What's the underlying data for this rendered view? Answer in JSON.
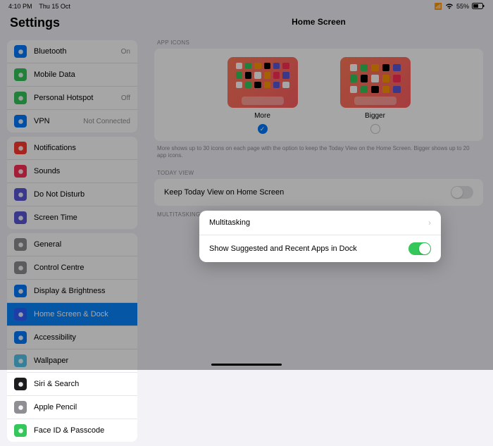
{
  "statusbar": {
    "time": "4:10 PM",
    "date": "Thu 15 Oct",
    "battery": "55%"
  },
  "sidebar": {
    "title": "Settings",
    "groups": [
      [
        {
          "label": "Bluetooth",
          "value": "On",
          "icon": "#007aff",
          "glyph": "bluetooth"
        },
        {
          "label": "Mobile Data",
          "value": "",
          "icon": "#34c759",
          "glyph": "antenna"
        },
        {
          "label": "Personal Hotspot",
          "value": "Off",
          "icon": "#34c759",
          "glyph": "link"
        },
        {
          "label": "VPN",
          "value": "Not Connected",
          "icon": "#007aff",
          "glyph": "vpn"
        }
      ],
      [
        {
          "label": "Notifications",
          "value": "",
          "icon": "#ff3b30",
          "glyph": "bell"
        },
        {
          "label": "Sounds",
          "value": "",
          "icon": "#ff2d55",
          "glyph": "speaker"
        },
        {
          "label": "Do Not Disturb",
          "value": "",
          "icon": "#5856d6",
          "glyph": "moon"
        },
        {
          "label": "Screen Time",
          "value": "",
          "icon": "#5856d6",
          "glyph": "hourglass"
        }
      ],
      [
        {
          "label": "General",
          "value": "",
          "icon": "#8e8e93",
          "glyph": "gear"
        },
        {
          "label": "Control Centre",
          "value": "",
          "icon": "#8e8e93",
          "glyph": "sliders"
        },
        {
          "label": "Display & Brightness",
          "value": "",
          "icon": "#007aff",
          "glyph": "sun"
        },
        {
          "label": "Home Screen & Dock",
          "value": "",
          "icon": "#2f5fff",
          "glyph": "grid",
          "active": true
        },
        {
          "label": "Accessibility",
          "value": "",
          "icon": "#007aff",
          "glyph": "person"
        },
        {
          "label": "Wallpaper",
          "value": "",
          "icon": "#54c7ec",
          "glyph": "flower"
        },
        {
          "label": "Siri & Search",
          "value": "",
          "icon": "#1c1c1e",
          "glyph": "siri"
        },
        {
          "label": "Apple Pencil",
          "value": "",
          "icon": "#8e8e93",
          "glyph": "pencil"
        },
        {
          "label": "Face ID & Passcode",
          "value": "",
          "icon": "#34c759",
          "glyph": "faceid"
        }
      ]
    ]
  },
  "content": {
    "title": "Home Screen",
    "appicons_label": "APP ICONS",
    "options": [
      {
        "label": "More",
        "selected": true
      },
      {
        "label": "Bigger",
        "selected": false
      }
    ],
    "hint": "More shows up to 30 icons on each page with the option to keep the Today View on the Home Screen. Bigger shows up to 20 app icons.",
    "todayview_label": "TODAY VIEW",
    "todayview_row": "Keep Today View on Home Screen",
    "multitasking_label": "MULTITASKING & DOCK",
    "multitasking_rows": [
      {
        "label": "Multitasking",
        "type": "chevron"
      },
      {
        "label": "Show Suggested and Recent Apps in Dock",
        "type": "toggle",
        "on": true
      }
    ]
  }
}
